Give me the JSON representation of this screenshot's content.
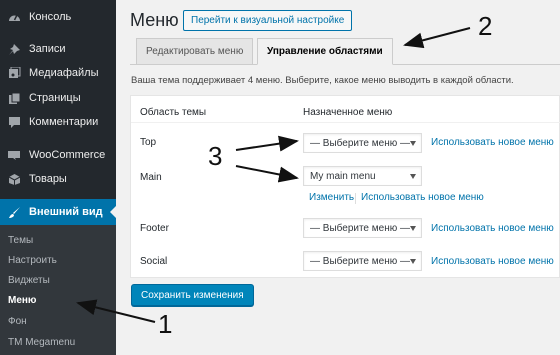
{
  "sidebar": {
    "items": [
      {
        "label": "Консоль",
        "icon": "dashboard-icon"
      },
      {
        "label": "Записи",
        "icon": "pin-icon"
      },
      {
        "label": "Медиафайлы",
        "icon": "media-icon"
      },
      {
        "label": "Страницы",
        "icon": "pages-icon"
      },
      {
        "label": "Комментарии",
        "icon": "comments-icon"
      },
      {
        "label": "WooCommerce",
        "icon": "woocommerce-icon"
      },
      {
        "label": "Товары",
        "icon": "products-icon"
      },
      {
        "label": "Внешний вид",
        "icon": "brush-icon"
      }
    ],
    "submenu": [
      "Темы",
      "Настроить",
      "Виджеты",
      "Меню",
      "Фон",
      "TM Megamenu"
    ]
  },
  "main": {
    "title": "Меню",
    "customize_button": "Перейти к визуальной настройке",
    "tabs": [
      "Редактировать меню",
      "Управление областями"
    ],
    "description": "Ваша тема поддерживает 4 меню. Выберите, какое меню выводить в каждой области.",
    "table": {
      "col_location": "Область темы",
      "col_menu": "Назначенное меню",
      "rows": [
        {
          "location": "Top",
          "selected": "— Выберите меню —",
          "link": "Использовать новое меню"
        },
        {
          "location": "Main",
          "selected": "My main menu",
          "edit": "Изменить",
          "link": "Использовать новое меню"
        },
        {
          "location": "Footer",
          "selected": "— Выберите меню —",
          "link": "Использовать новое меню"
        },
        {
          "location": "Social",
          "selected": "— Выберите меню —",
          "link": "Использовать новое меню"
        }
      ]
    },
    "save_button": "Сохранить изменения"
  },
  "annotations": [
    "1",
    "2",
    "3"
  ],
  "colors": {
    "sidebar": "#23282d",
    "accent": "#0073aa",
    "button": "#0085ba"
  }
}
